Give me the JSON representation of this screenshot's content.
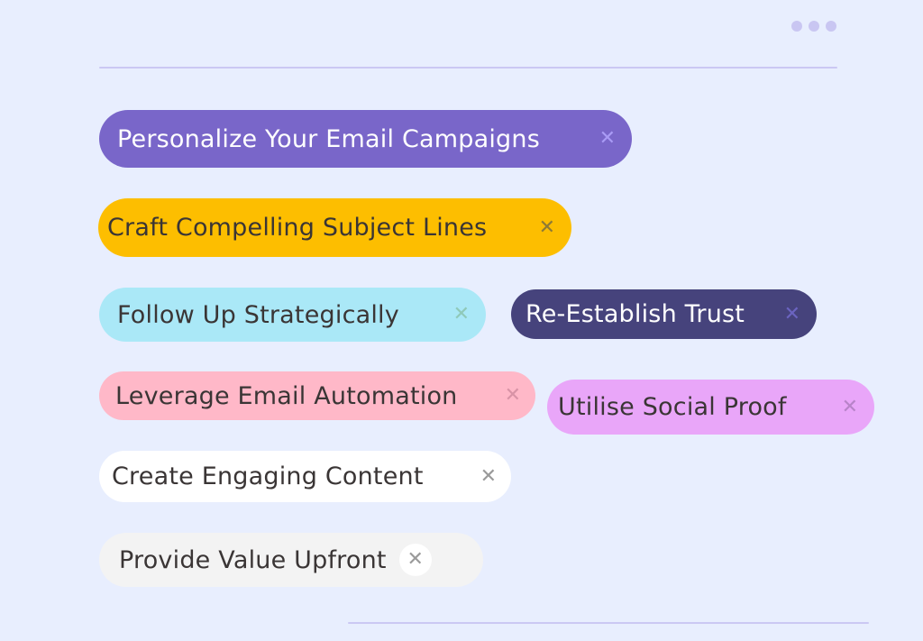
{
  "menu": {
    "icon": "more-horizontal-icon"
  },
  "chips": [
    {
      "label": "Personalize Your Email Campaigns",
      "bg": "#7966c9",
      "fg": "#ffffff",
      "x_color": "#a99bf5",
      "close_icon": "close-icon"
    },
    {
      "label": "Craft Compelling Subject Lines",
      "bg": "#fdbe00",
      "fg": "#3a3535",
      "x_color": "#8d7a36",
      "close_icon": "close-icon"
    },
    {
      "label": "Follow Up Strategically",
      "bg": "#aae8f7",
      "fg": "#3a3535",
      "x_color": "#8fc9b9",
      "close_icon": "close-icon"
    },
    {
      "label": "Re-Establish Trust",
      "bg": "#46437c",
      "fg": "#ffffff",
      "x_color": "#6b64c0",
      "close_icon": "close-icon"
    },
    {
      "label": "Leverage Email Automation",
      "bg": "#ffb8c8",
      "fg": "#3a3535",
      "x_color": "#d893a6",
      "close_icon": "close-icon"
    },
    {
      "label": "Utilise Social Proof",
      "bg": "#e9a6f9",
      "fg": "#3a3535",
      "x_color": "#b883c9",
      "close_icon": "close-icon"
    },
    {
      "label": "Create Engaging Content",
      "bg": "#ffffff",
      "fg": "#3a3535",
      "x_color": "#9a9a9a",
      "close_icon": "close-icon"
    },
    {
      "label": "Provide Value Upfront",
      "bg": "#f3f3f3",
      "fg": "#3a3535",
      "x_color": "#9a9a9a",
      "close_icon": "close-icon"
    }
  ],
  "close_glyph": "✕"
}
